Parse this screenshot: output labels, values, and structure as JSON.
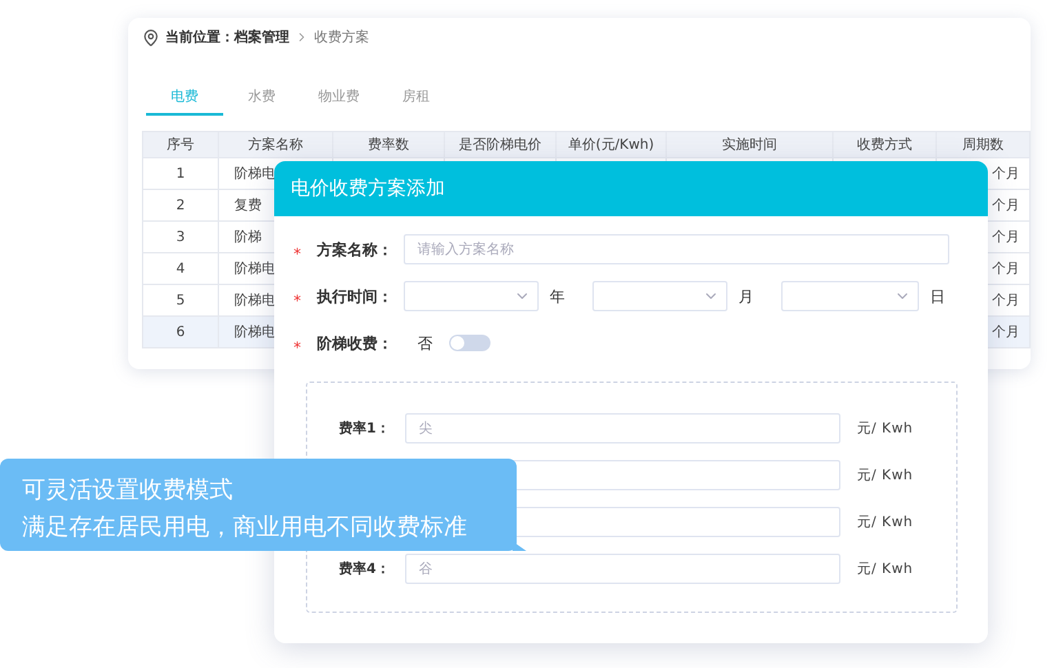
{
  "breadcrumb": {
    "label": "当前位置：",
    "path": "档案管理",
    "current": "收费方案"
  },
  "tabs": [
    {
      "label": "电费",
      "selected": true
    },
    {
      "label": "水费",
      "selected": false
    },
    {
      "label": "物业费",
      "selected": false
    },
    {
      "label": "房租",
      "selected": false
    }
  ],
  "table": {
    "columns": [
      "序号",
      "方案名称",
      "费率数",
      "是否阶梯电价",
      "单价(元/Kwh)",
      "实施时间",
      "收费方式",
      "周期数"
    ],
    "rows": [
      {
        "index": "1",
        "name": "阶梯电",
        "period": "个月",
        "selected": false
      },
      {
        "index": "2",
        "name": "复费",
        "period": "个月",
        "selected": false
      },
      {
        "index": "3",
        "name": "阶梯",
        "period": "个月",
        "selected": false
      },
      {
        "index": "4",
        "name": "阶梯电",
        "period": "个月",
        "selected": false
      },
      {
        "index": "5",
        "name": "阶梯电",
        "period": "个月",
        "selected": false
      },
      {
        "index": "6",
        "name": "阶梯电",
        "period": "个月",
        "selected": true
      }
    ]
  },
  "dialog": {
    "title": "电价收费方案添加",
    "required_mark": "*",
    "fields": [
      {
        "kind": "text",
        "required": true,
        "label": "方案名称：",
        "placeholder": "请输入方案名称"
      },
      {
        "kind": "date",
        "required": true,
        "label": "执行时间：",
        "units": [
          "年",
          "月",
          "日"
        ]
      },
      {
        "kind": "toggle",
        "required": true,
        "label": "阶梯收费：",
        "value": "否",
        "on": false
      }
    ],
    "rates": [
      {
        "label": "费率1：",
        "placeholder": "尖",
        "unit": "元/ Kwh"
      },
      {
        "unit": "元/ Kwh"
      },
      {
        "unit": "元/ Kwh"
      },
      {
        "label": "费率4：",
        "placeholder": "谷",
        "unit": "元/ Kwh"
      }
    ]
  },
  "callout": {
    "lines": [
      "可灵活设置收费模式",
      "满足存在居民用电，商业用电不同收费标准"
    ]
  }
}
